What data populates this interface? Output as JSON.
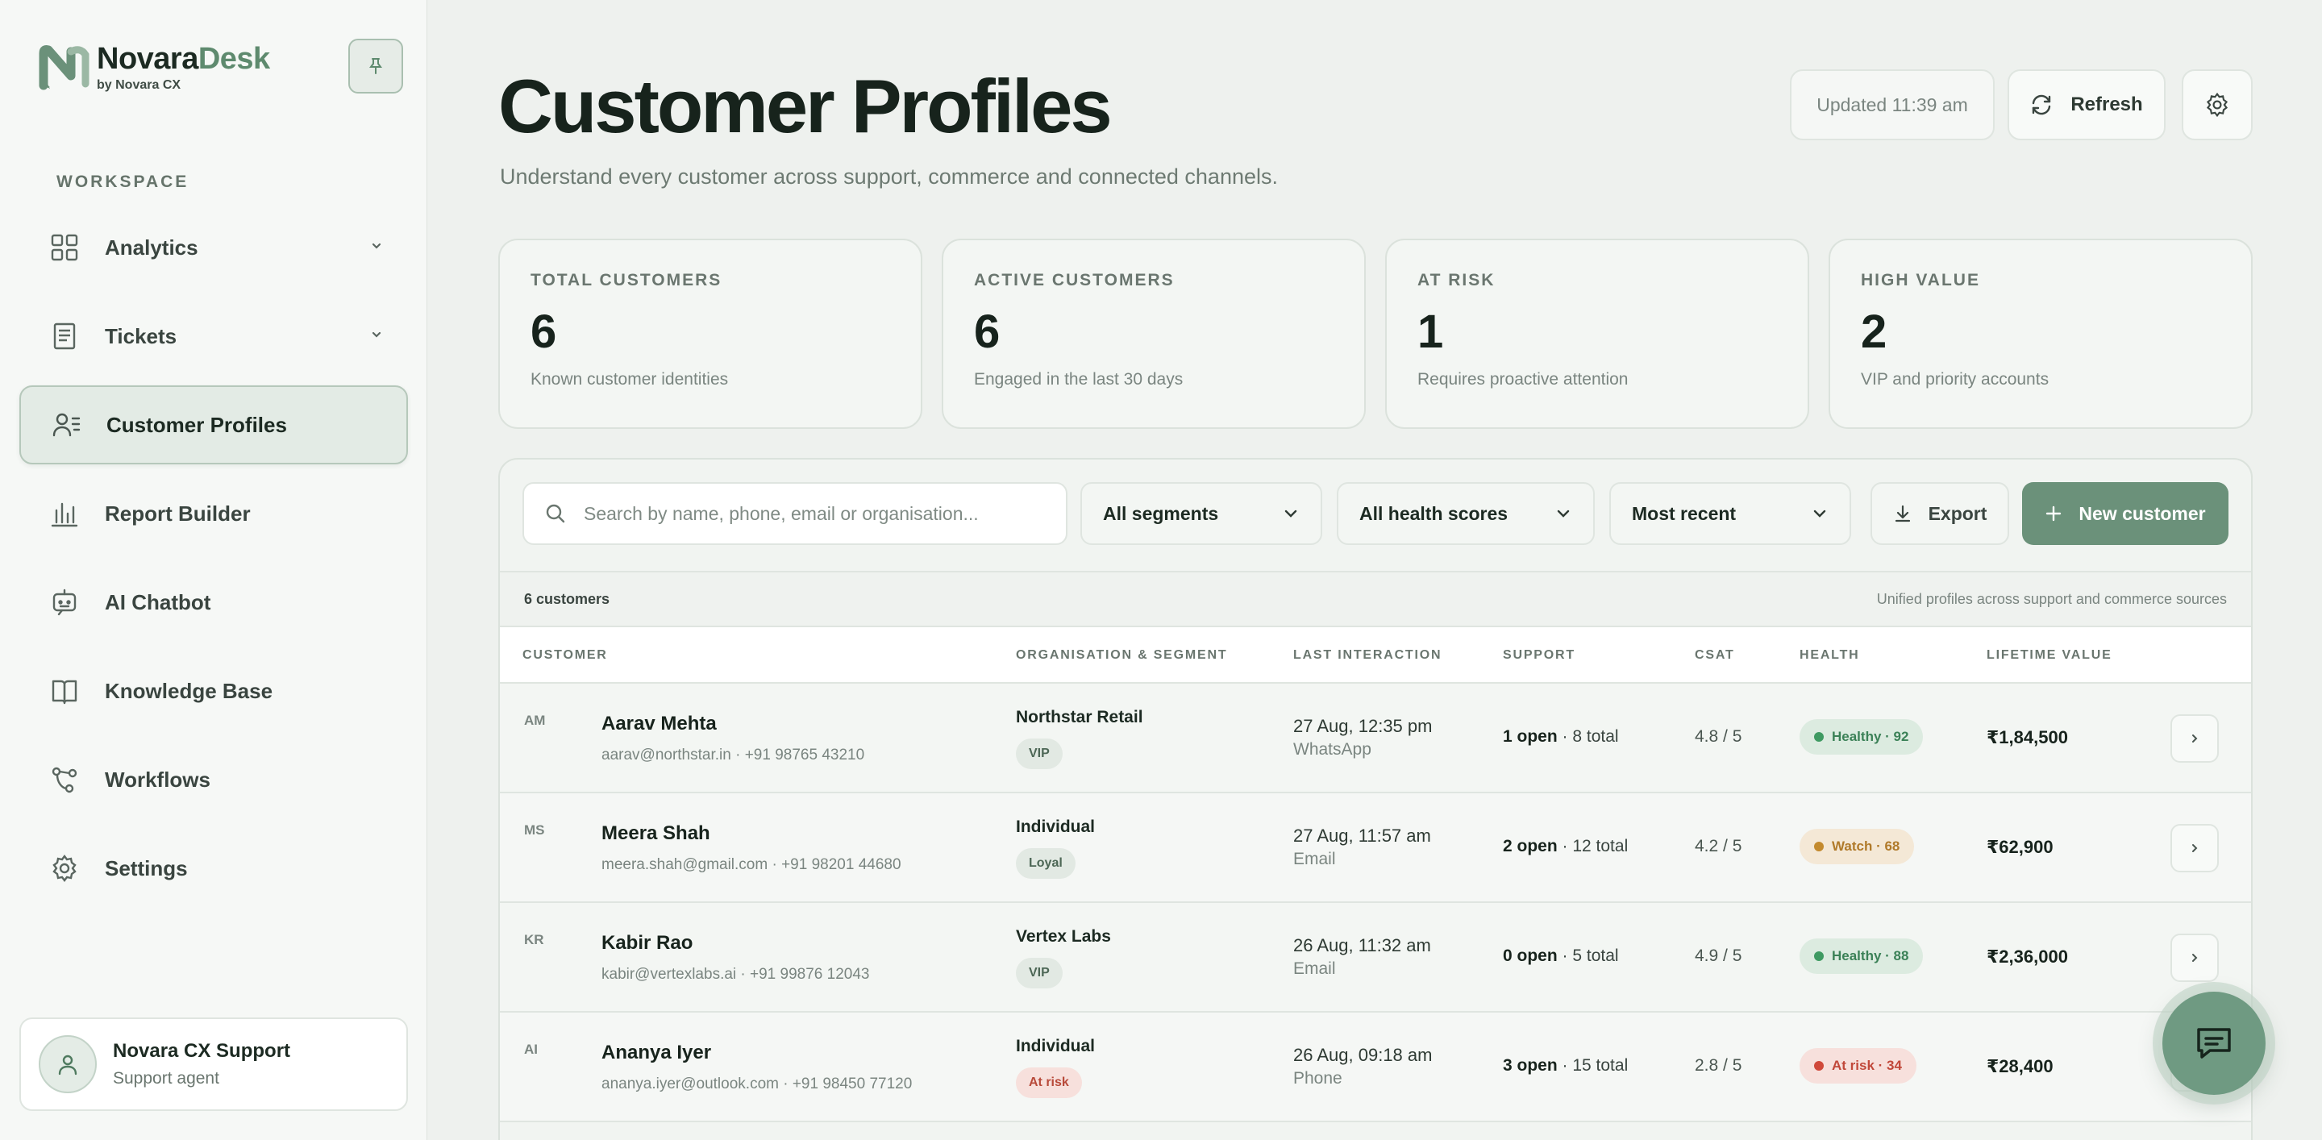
{
  "brand": {
    "name_part1": "Novara",
    "name_part2": "Desk",
    "sub": "by Novara CX"
  },
  "sidebar": {
    "section_label": "WORKSPACE",
    "items": [
      {
        "label": "Analytics",
        "icon": "grid-icon",
        "has_chevron": true
      },
      {
        "label": "Tickets",
        "icon": "document-icon",
        "has_chevron": true
      },
      {
        "label": "Customer Profiles",
        "icon": "users-list-icon",
        "active": true
      },
      {
        "label": "Report Builder",
        "icon": "bar-chart-icon"
      },
      {
        "label": "AI Chatbot",
        "icon": "bot-icon"
      },
      {
        "label": "Knowledge Base",
        "icon": "book-icon"
      },
      {
        "label": "Workflows",
        "icon": "workflow-icon"
      },
      {
        "label": "Settings",
        "icon": "gear-icon"
      }
    ],
    "user": {
      "name": "Novara CX Support",
      "role": "Support agent"
    }
  },
  "header": {
    "title": "Customer Profiles",
    "subtitle": "Understand every customer across support, commerce and connected channels.",
    "updated": "Updated 11:39 am",
    "refresh_label": "Refresh"
  },
  "stats": [
    {
      "label": "TOTAL CUSTOMERS",
      "value": "6",
      "desc": "Known customer identities"
    },
    {
      "label": "ACTIVE CUSTOMERS",
      "value": "6",
      "desc": "Engaged in the last 30 days"
    },
    {
      "label": "AT RISK",
      "value": "1",
      "desc": "Requires proactive attention"
    },
    {
      "label": "HIGH VALUE",
      "value": "2",
      "desc": "VIP and priority accounts"
    }
  ],
  "toolbar": {
    "search_placeholder": "Search by name, phone, email or organisation...",
    "segment_filter": "All segments",
    "health_filter": "All health scores",
    "sort": "Most recent",
    "export_label": "Export",
    "new_label": "New customer"
  },
  "table": {
    "count": "6 customers",
    "note": "Unified profiles across support and commerce sources",
    "columns": [
      "CUSTOMER",
      "ORGANISATION & SEGMENT",
      "LAST INTERACTION",
      "SUPPORT",
      "CSAT",
      "HEALTH",
      "LIFETIME VALUE"
    ],
    "rows": [
      {
        "initials": "AM",
        "name": "Aarav Mehta",
        "contact": "aarav@northstar.in · +91 98765 43210",
        "org": "Northstar Retail",
        "segment": "VIP",
        "segment_kind": "vip",
        "time": "27 Aug, 12:35 pm",
        "channel": "WhatsApp",
        "open": "1 open",
        "total": " · 8 total",
        "csat": "4.8 / 5",
        "health": "Healthy · 92",
        "health_kind": "good",
        "ltv": "₹1,84,500"
      },
      {
        "initials": "MS",
        "name": "Meera Shah",
        "contact": "meera.shah@gmail.com · +91 98201 44680",
        "org": "Individual",
        "segment": "Loyal",
        "segment_kind": "loyal",
        "time": "27 Aug, 11:57 am",
        "channel": "Email",
        "open": "2 open",
        "total": " · 12 total",
        "csat": "4.2 / 5",
        "health": "Watch · 68",
        "health_kind": "watch",
        "ltv": "₹62,900"
      },
      {
        "initials": "KR",
        "name": "Kabir Rao",
        "contact": "kabir@vertexlabs.ai · +91 99876 12043",
        "org": "Vertex Labs",
        "segment": "VIP",
        "segment_kind": "vip",
        "time": "26 Aug, 11:32 am",
        "channel": "Email",
        "open": "0 open",
        "total": " · 5 total",
        "csat": "4.9 / 5",
        "health": "Healthy · 88",
        "health_kind": "good",
        "ltv": "₹2,36,000"
      },
      {
        "initials": "AI",
        "name": "Ananya Iyer",
        "contact": "ananya.iyer@outlook.com · +91 98450 77120",
        "org": "Individual",
        "segment": "At risk",
        "segment_kind": "risk",
        "time": "26 Aug, 09:18 am",
        "channel": "Phone",
        "open": "3 open",
        "total": " · 15 total",
        "csat": "2.8 / 5",
        "health": "At risk · 34",
        "health_kind": "risk",
        "ltv": "₹28,400"
      }
    ]
  },
  "colors": {
    "accent": "#6b917a",
    "healthy": "#3f9a62",
    "watch": "#c38a2e",
    "risk": "#d0493a"
  }
}
